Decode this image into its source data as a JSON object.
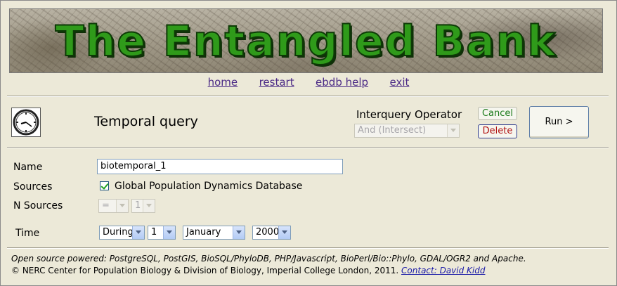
{
  "banner": {
    "title": "The Entangled Bank"
  },
  "nav": {
    "items": [
      "home",
      "restart",
      "ebdb help",
      "exit"
    ]
  },
  "query": {
    "title": "Temporal query",
    "interquery_label": "Interquery Operator",
    "interquery_value": "And (Intersect)",
    "cancel_label": "Cancel",
    "delete_label": "Delete",
    "run_label": "Run >"
  },
  "form": {
    "name_label": "Name",
    "name_value": "biotemporal_1",
    "sources_label": "Sources",
    "source_name": "Global Population Dynamics Database",
    "source_checked": true,
    "nsources_label": "N Sources",
    "nsources_op": "=",
    "nsources_value": "1",
    "time_label": "Time",
    "time_mode": "During",
    "time_day": "1",
    "time_month": "January",
    "time_year": "2000"
  },
  "footer": {
    "powered": "Open source powered: PostgreSQL, PostGIS, BioSQL/PhyloDB, PHP/Javascript, BioPerl/Bio::Phylo, GDAL/OGR2 and Apache.",
    "copyright": "© NERC Center for Population Biology & Division of Biology, Imperial College London, 2011.",
    "contact": "Contact: David Kidd"
  }
}
